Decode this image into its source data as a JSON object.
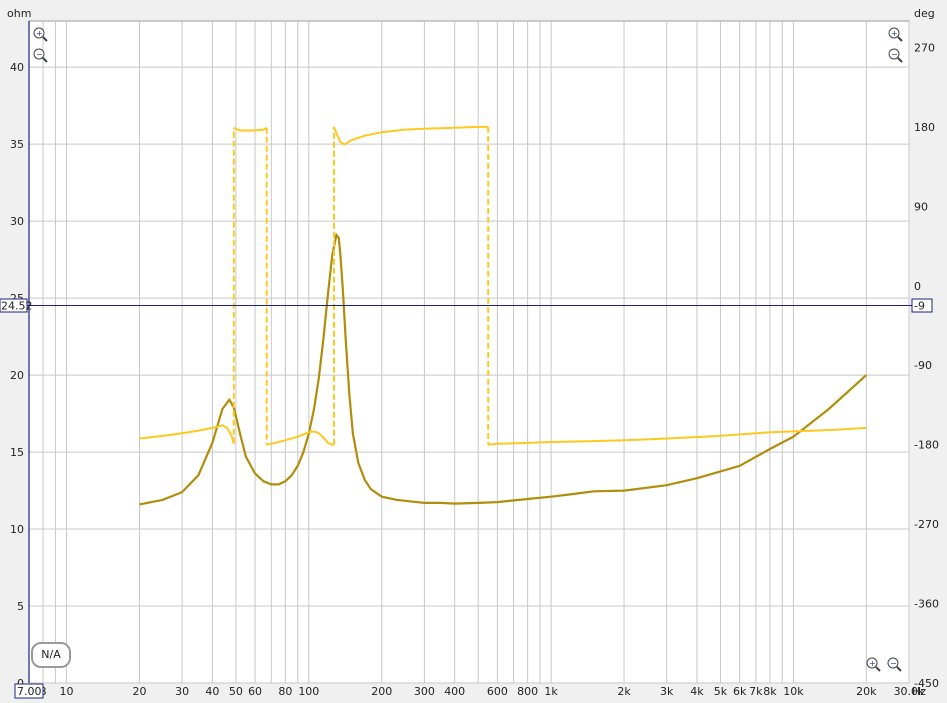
{
  "units": {
    "left": "ohm",
    "right": "deg",
    "x": "Hz"
  },
  "cursor": {
    "left_value": "24.52",
    "right_value": "-9",
    "x_value": "7.00"
  },
  "na_label": "N/A",
  "colors": {
    "impedance": "#b08d0a",
    "phase": "#ffc81e",
    "cursor": "#1a237e",
    "grid": "#c8c8c8",
    "background": "#ffffff"
  },
  "icons": [
    "zoom-in-icon",
    "zoom-out-icon"
  ],
  "chart_data": {
    "type": "line",
    "x_scale": "log",
    "xlim": [
      7,
      30000
    ],
    "ylim_left": [
      0,
      43
    ],
    "ylim_right": [
      -450,
      300
    ],
    "grid": true,
    "x_ticks": [
      {
        "v": 8,
        "label": "8"
      },
      {
        "v": 10,
        "label": "10"
      },
      {
        "v": 20,
        "label": "20"
      },
      {
        "v": 30,
        "label": "30"
      },
      {
        "v": 40,
        "label": "40"
      },
      {
        "v": 50,
        "label": "50"
      },
      {
        "v": 60,
        "label": "60"
      },
      {
        "v": 80,
        "label": "80"
      },
      {
        "v": 100,
        "label": "100"
      },
      {
        "v": 200,
        "label": "200"
      },
      {
        "v": 300,
        "label": "300"
      },
      {
        "v": 400,
        "label": "400"
      },
      {
        "v": 600,
        "label": "600"
      },
      {
        "v": 800,
        "label": "800"
      },
      {
        "v": 1000,
        "label": "1k"
      },
      {
        "v": 2000,
        "label": "2k"
      },
      {
        "v": 3000,
        "label": "3k"
      },
      {
        "v": 4000,
        "label": "4k"
      },
      {
        "v": 5000,
        "label": "5k"
      },
      {
        "v": 6000,
        "label": "6k"
      },
      {
        "v": 7000,
        "label": "7k"
      },
      {
        "v": 8000,
        "label": "8k"
      },
      {
        "v": 10000,
        "label": "10k"
      },
      {
        "v": 20000,
        "label": "20k"
      },
      {
        "v": 30000,
        "label": "30.0k"
      }
    ],
    "y_ticks_left": [
      {
        "v": 0,
        "label": "0"
      },
      {
        "v": 5,
        "label": "5"
      },
      {
        "v": 10,
        "label": "10"
      },
      {
        "v": 15,
        "label": "15"
      },
      {
        "v": 20,
        "label": "20"
      },
      {
        "v": 25,
        "label": "25"
      },
      {
        "v": 30,
        "label": "30"
      },
      {
        "v": 35,
        "label": "35"
      },
      {
        "v": 40,
        "label": "40"
      }
    ],
    "y_ticks_right": [
      {
        "v": 270,
        "label": "270"
      },
      {
        "v": 180,
        "label": "180"
      },
      {
        "v": 90,
        "label": "90"
      },
      {
        "v": 0,
        "label": "0"
      },
      {
        "v": -90,
        "label": "-90"
      },
      {
        "v": -180,
        "label": "-180"
      },
      {
        "v": -270,
        "label": "-270"
      },
      {
        "v": -360,
        "label": "-360"
      },
      {
        "v": -450,
        "label": "-450"
      }
    ],
    "series": [
      {
        "axis": "left",
        "x": [
          20,
          25,
          30,
          35,
          40,
          44,
          47,
          49,
          52,
          55,
          60,
          65,
          70,
          75,
          80,
          85,
          90,
          95,
          100,
          105,
          110,
          115,
          120,
          125,
          130,
          133,
          135,
          138,
          142,
          147,
          152,
          160,
          170,
          180,
          200,
          230,
          260,
          300,
          350,
          400,
          500,
          600,
          800,
          1000,
          1200,
          1500,
          2000,
          3000,
          4000,
          6000,
          8000,
          10000,
          14000,
          20000
        ],
        "y": [
          11.6,
          11.9,
          12.4,
          13.5,
          15.6,
          17.8,
          18.4,
          17.9,
          16.2,
          14.7,
          13.6,
          13.1,
          12.9,
          12.9,
          13.1,
          13.5,
          14.1,
          15.0,
          16.2,
          17.8,
          19.8,
          22.4,
          25.3,
          27.8,
          29.1,
          28.9,
          27.8,
          25.7,
          22.3,
          18.7,
          16.2,
          14.3,
          13.2,
          12.6,
          12.1,
          11.9,
          11.8,
          11.7,
          11.7,
          11.65,
          11.7,
          11.75,
          11.95,
          12.1,
          12.25,
          12.45,
          12.5,
          12.85,
          13.3,
          14.1,
          15.2,
          16.0,
          17.8,
          20.0
        ]
      },
      {
        "axis": "right",
        "x": [
          20,
          25,
          30,
          35,
          40,
          44,
          46,
          48,
          49,
          49,
          52,
          55,
          60,
          65,
          67,
          67,
          70,
          80,
          90,
          100,
          105,
          110,
          115,
          120,
          125,
          127,
          127,
          130,
          135,
          140,
          150,
          170,
          200,
          250,
          300,
          400,
          500,
          550,
          550,
          600,
          800,
          1000,
          1500,
          2000,
          3000,
          5000,
          8000,
          10000,
          15000,
          20000
        ],
        "y": [
          -173,
          -170,
          -167,
          -164,
          -161,
          -158,
          -161,
          -170,
          -179,
          179,
          176,
          176,
          176,
          177,
          179,
          -180,
          -179,
          -175,
          -171,
          -166,
          -165,
          -167,
          -172,
          -178,
          -180,
          -180,
          180,
          173,
          163,
          160,
          165,
          170,
          174,
          177,
          178,
          179,
          180,
          180,
          -180,
          -179,
          -178,
          -177,
          -176,
          -175,
          -173,
          -170,
          -166,
          -165,
          -163,
          -161
        ]
      }
    ]
  }
}
